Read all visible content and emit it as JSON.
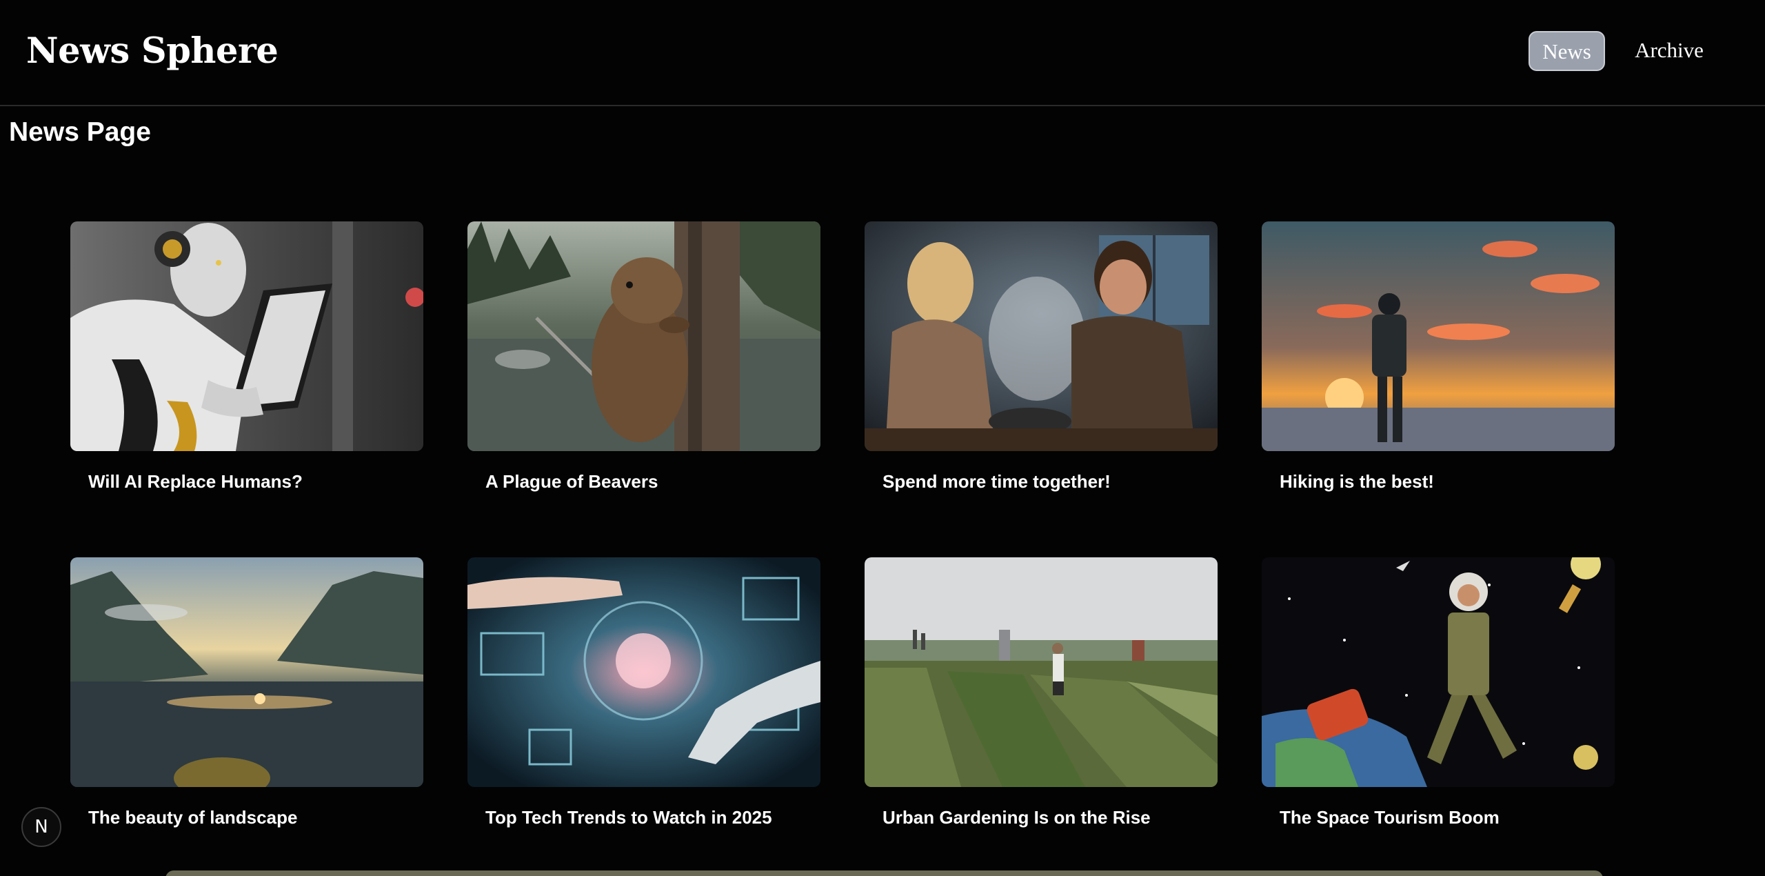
{
  "header": {
    "brand": "News Sphere",
    "nav": [
      {
        "label": "News",
        "active": true
      },
      {
        "label": "Archive",
        "active": false
      }
    ]
  },
  "page": {
    "title": "News Page"
  },
  "articles": [
    {
      "title": "Will AI Replace Humans?",
      "image_icon": "robot-with-tablet-image"
    },
    {
      "title": "A Plague of Beavers",
      "image_icon": "beaver-on-tree-image"
    },
    {
      "title": "Spend more time together!",
      "image_icon": "couple-cooking-image"
    },
    {
      "title": "Hiking is the best!",
      "image_icon": "hiker-at-sunset-image"
    },
    {
      "title": "The beauty of landscape",
      "image_icon": "mountain-lake-image"
    },
    {
      "title": "Top Tech Trends to Watch in 2025",
      "image_icon": "tech-hologram-image"
    },
    {
      "title": "Urban Gardening Is on the Rise",
      "image_icon": "rooftop-garden-image"
    },
    {
      "title": "The Space Tourism Boom",
      "image_icon": "space-traveler-image"
    }
  ],
  "dev_badge": {
    "label": "N",
    "icon": "nextjs-logo-icon"
  },
  "colors": {
    "background": "#030303",
    "active_nav": "#9aa1ad",
    "text": "#ffffff"
  }
}
